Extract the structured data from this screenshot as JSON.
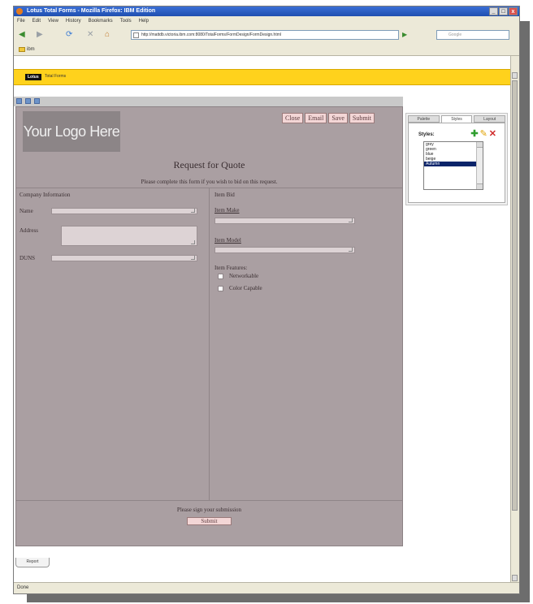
{
  "window": {
    "title": "Lotus Total Forms - Mozilla Firefox: IBM Edition",
    "controls": [
      "_",
      "□",
      "x"
    ]
  },
  "menu": [
    "File",
    "Edit",
    "View",
    "History",
    "Bookmarks",
    "Tools",
    "Help"
  ],
  "nav": {
    "back": "◀",
    "forward": "▶",
    "reload": "⟳",
    "stop": "✕",
    "home": "⌂",
    "url": "http://mattdb.victoria.ibm.com:8080/TotalForms/FormDesign/FormDesign.html",
    "search_placeholder": "Google"
  },
  "bookmarks": [
    {
      "label": "ibm"
    }
  ],
  "app": {
    "brand": "Lotus",
    "name": "Total Forms"
  },
  "form": {
    "logo": "Your Logo Here",
    "buttons": [
      "Close",
      "Email",
      "Save",
      "Submit"
    ],
    "title": "Request for Quote",
    "subtitle": "Please complete this form if you wish to bid on this request.",
    "company_section": "Company Information",
    "name_label": "Name",
    "address_label": "Address",
    "duns_label": "DUNS",
    "item_section": "Item Bid",
    "item_make_label": "Item Make",
    "item_model_label": "Item Model",
    "item_features_label": "Item Features:",
    "features": [
      "Networkable",
      "Color Capable"
    ],
    "sign_text": "Please sign your submission",
    "bottom_submit": "Submit"
  },
  "panel": {
    "tabs": [
      "Palette",
      "Styles",
      "Layout"
    ],
    "active_tab": "Styles",
    "styles_label": "Styles:",
    "style_items": [
      "grey",
      "green",
      "blue",
      "beige",
      "Autumn"
    ],
    "selected_style": "Autumn"
  },
  "report_tab": "Report",
  "status": "Done",
  "colors": {
    "form_bg": "#aa9fa2",
    "button_bg": "#f3d6d6",
    "banner": "#ffd21c",
    "titlebar": "#1f4fb0"
  }
}
